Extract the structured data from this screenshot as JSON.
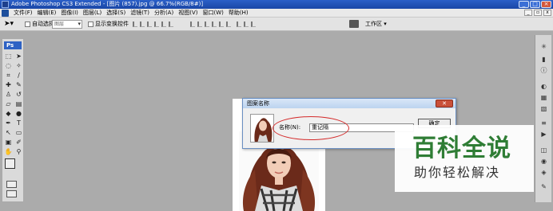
{
  "window": {
    "title": "Adobe Photoshop CS3 Extended - [图片 (857).jpg @ 66.7%(RGB/8#)]",
    "buttons": [
      "_",
      "□",
      "×"
    ]
  },
  "menubar": {
    "items": [
      "文件(F)",
      "编辑(E)",
      "图像(I)",
      "图层(L)",
      "选择(S)",
      "滤镜(T)",
      "分析(A)",
      "视图(V)",
      "窗口(W)",
      "帮助(H)"
    ]
  },
  "options": {
    "auto_select_label": "自动选择:",
    "auto_select_value": "图层",
    "show_transform_label": "显示变换控件",
    "workspace_label": "工作区 ▾"
  },
  "toolbox": {
    "logo": "Ps"
  },
  "dialog": {
    "title": "图案名称",
    "name_label": "名称(N):",
    "name_value": "重记隔",
    "ok_label": "确定",
    "close_label": "✕"
  },
  "watermark": {
    "title": "百科全说",
    "subtitle": "助你轻松解决"
  },
  "colors": {
    "titlebar": "#1f4fb4",
    "canvas_bg": "#ababab",
    "highlight_oval": "#d42a2a",
    "watermark_green": "#2f7d35"
  }
}
